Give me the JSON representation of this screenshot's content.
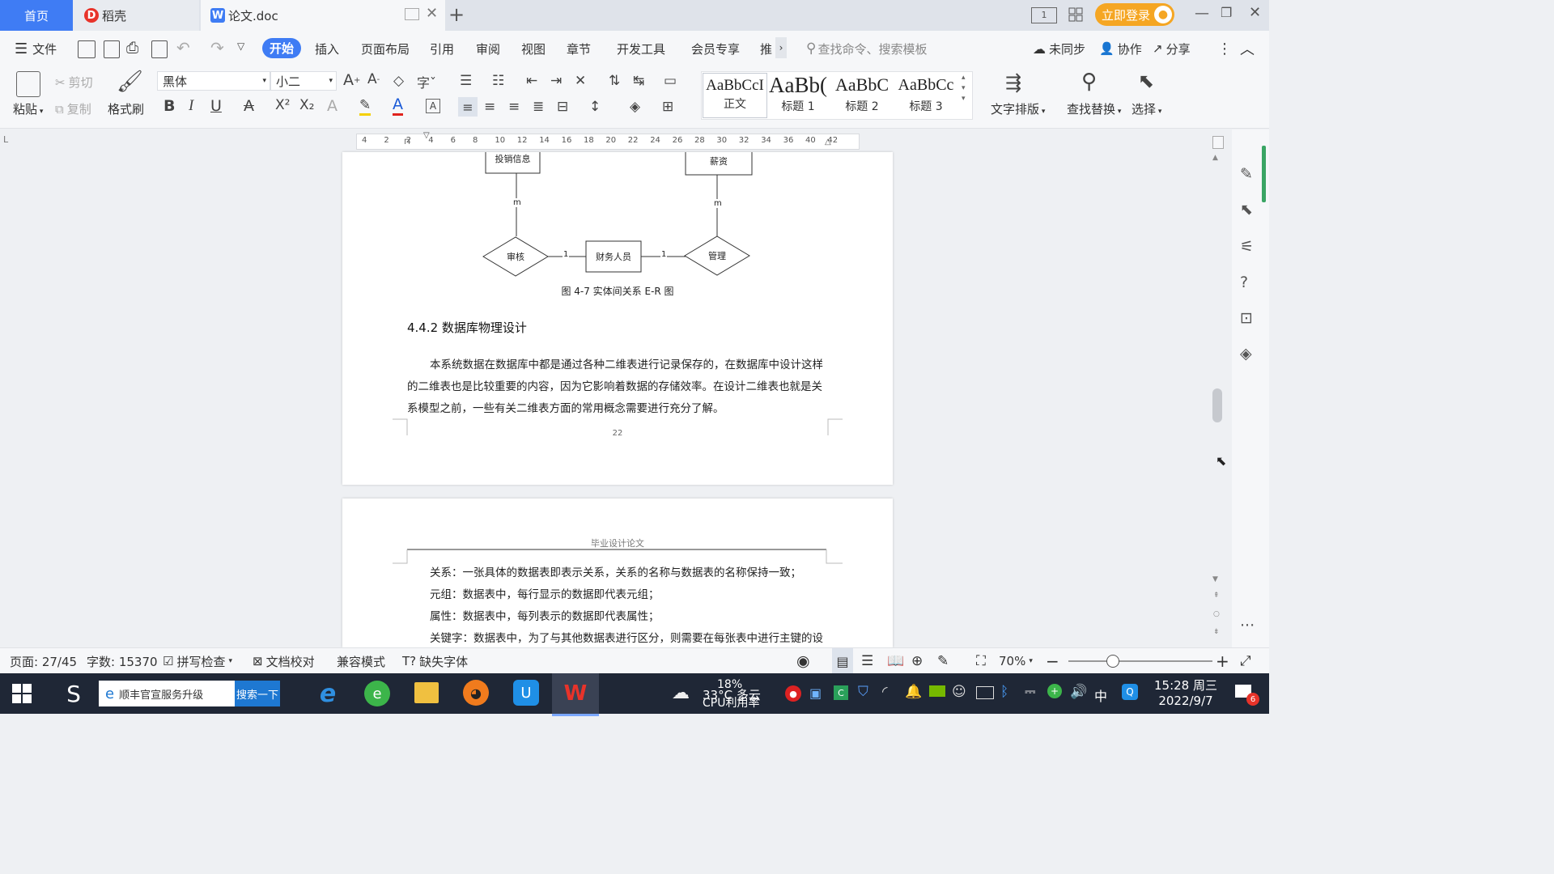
{
  "tabs": {
    "home": "首页",
    "daoke": "稻壳",
    "doc": "论文.doc"
  },
  "titlebar": {
    "login": "立即登录"
  },
  "menu": {
    "file": "文件",
    "items": [
      "开始",
      "插入",
      "页面布局",
      "引用",
      "审阅",
      "视图",
      "章节",
      "开发工具",
      "会员专享",
      "推"
    ],
    "search_placeholder": "查找命令、搜索模板",
    "sync": "未同步",
    "collab": "协作",
    "share": "分享"
  },
  "ribbon": {
    "paste": "粘贴",
    "cut": "剪切",
    "copy": "复制",
    "format_painter": "格式刷",
    "font_name": "黑体",
    "font_size": "小二",
    "styles": [
      {
        "preview": "AaBbCcI",
        "label": "正文"
      },
      {
        "preview": "AaBb(",
        "label": "标题 1"
      },
      {
        "preview": "AaBbC",
        "label": "标题 2"
      },
      {
        "preview": "AaBbCc",
        "label": "标题 3"
      }
    ],
    "text_layout": "文字排版",
    "find_replace": "查找替换",
    "select": "选择"
  },
  "ruler": {
    "ticks": [
      "4",
      "2",
      "2",
      "4",
      "6",
      "8",
      "10",
      "12",
      "14",
      "16",
      "18",
      "20",
      "22",
      "24",
      "26",
      "28",
      "30",
      "32",
      "34",
      "36",
      "40",
      "42"
    ]
  },
  "diagram": {
    "top_left_box": "投销信息",
    "top_right_box": "薪资",
    "left_diamond": "审核",
    "center_box": "财务人员",
    "right_diamond": "管理",
    "card_m_left": "m",
    "card_m_right": "m",
    "card_1_left": "1",
    "card_1_right": "1",
    "caption": "图 4-7  实体间关系 E-R 图"
  },
  "page1": {
    "section_title": "4.4.2  数据库物理设计",
    "para_lines": [
      "本系统数据在数据库中都是通过各种二维表进行记录保存的，在数据库中设计这样",
      "的二维表也是比较重要的内容，因为它影响着数据的存储效率。在设计二维表也就是关",
      "系模型之前，一些有关二维表方面的常用概念需要进行充分了解。"
    ],
    "page_number": "22"
  },
  "page2": {
    "header": "毕业设计论文",
    "lines": [
      "关系：一张具体的数据表即表示关系，关系的名称与数据表的名称保持一致；",
      "元组：数据表中，每行显示的数据即代表元组；",
      "属性：数据表中，每列表示的数据即代表属性；",
      "关键字：数据表中，为了与其他数据表进行区分，则需要在每张表中进行主键的设"
    ]
  },
  "status": {
    "page": "页面: 27/45",
    "words": "字数: 15370",
    "spell": "拼写检查",
    "proof": "文档校对",
    "compat": "兼容模式",
    "missing_font": "缺失字体",
    "zoom": "70%"
  },
  "taskbar": {
    "search_text": "顺丰官宣服务升级",
    "search_button": "搜索一下",
    "weather_temp": "33°C 多云",
    "cpu_percent": "18%",
    "cpu_label": "CPU利用率",
    "ime": "中",
    "time": "15:28 周三",
    "date": "2022/9/7",
    "notification_count": "6"
  },
  "colors": {
    "accent": "#3f7cf4",
    "login": "#f5a623",
    "wps_red": "#e8332a"
  }
}
